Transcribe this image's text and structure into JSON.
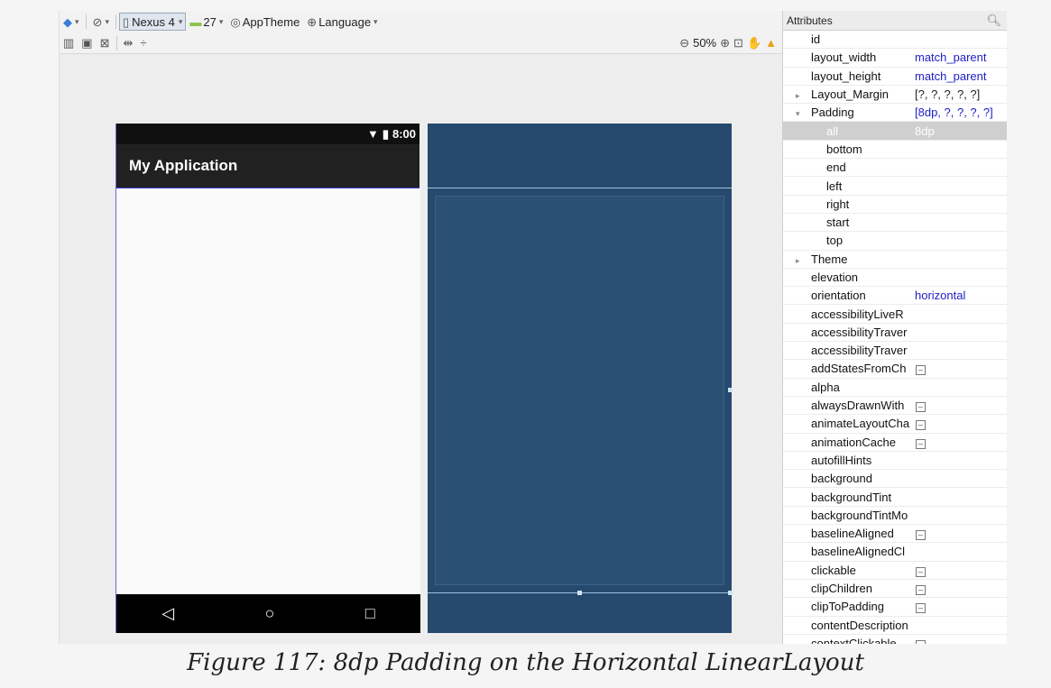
{
  "toolbar": {
    "device": "Nexus 4",
    "api_level": "27",
    "theme": "AppTheme",
    "language": "Language",
    "zoom": "50%"
  },
  "phone": {
    "time": "8:00",
    "app_title": "My Application",
    "nav_back": "◁",
    "nav_home": "○",
    "nav_recent": "□"
  },
  "attributes": {
    "header": "Attributes",
    "rows": [
      {
        "name": "id",
        "value": ""
      },
      {
        "name": "layout_width",
        "value": "match_parent"
      },
      {
        "name": "layout_height",
        "value": "match_parent"
      },
      {
        "name": "Layout_Margin",
        "value": "[?, ?, ?, ?, ?]"
      },
      {
        "name": "Padding",
        "value": "[8dp, ?, ?, ?, ?]"
      },
      {
        "name": "all",
        "value": "8dp"
      },
      {
        "name": "bottom",
        "value": ""
      },
      {
        "name": "end",
        "value": ""
      },
      {
        "name": "left",
        "value": ""
      },
      {
        "name": "right",
        "value": ""
      },
      {
        "name": "start",
        "value": ""
      },
      {
        "name": "top",
        "value": ""
      },
      {
        "name": "Theme",
        "value": ""
      },
      {
        "name": "elevation",
        "value": ""
      },
      {
        "name": "orientation",
        "value": "horizontal"
      },
      {
        "name": "accessibilityLiveR",
        "value": ""
      },
      {
        "name": "accessibilityTraver",
        "value": ""
      },
      {
        "name": "accessibilityTraver",
        "value": ""
      },
      {
        "name": "addStatesFromCh",
        "value": ""
      },
      {
        "name": "alpha",
        "value": ""
      },
      {
        "name": "alwaysDrawnWith",
        "value": ""
      },
      {
        "name": "animateLayoutCha",
        "value": ""
      },
      {
        "name": "animationCache",
        "value": ""
      },
      {
        "name": "autofillHints",
        "value": ""
      },
      {
        "name": "background",
        "value": ""
      },
      {
        "name": "backgroundTint",
        "value": ""
      },
      {
        "name": "backgroundTintMo",
        "value": ""
      },
      {
        "name": "baselineAligned",
        "value": ""
      },
      {
        "name": "baselineAlignedCl",
        "value": ""
      },
      {
        "name": "clickable",
        "value": ""
      },
      {
        "name": "clipChildren",
        "value": ""
      },
      {
        "name": "clipToPadding",
        "value": ""
      },
      {
        "name": "contentDescription",
        "value": ""
      },
      {
        "name": "contextClickable",
        "value": ""
      }
    ]
  },
  "caption": "Figure 117: 8dp Padding on the Horizontal LinearLayout"
}
